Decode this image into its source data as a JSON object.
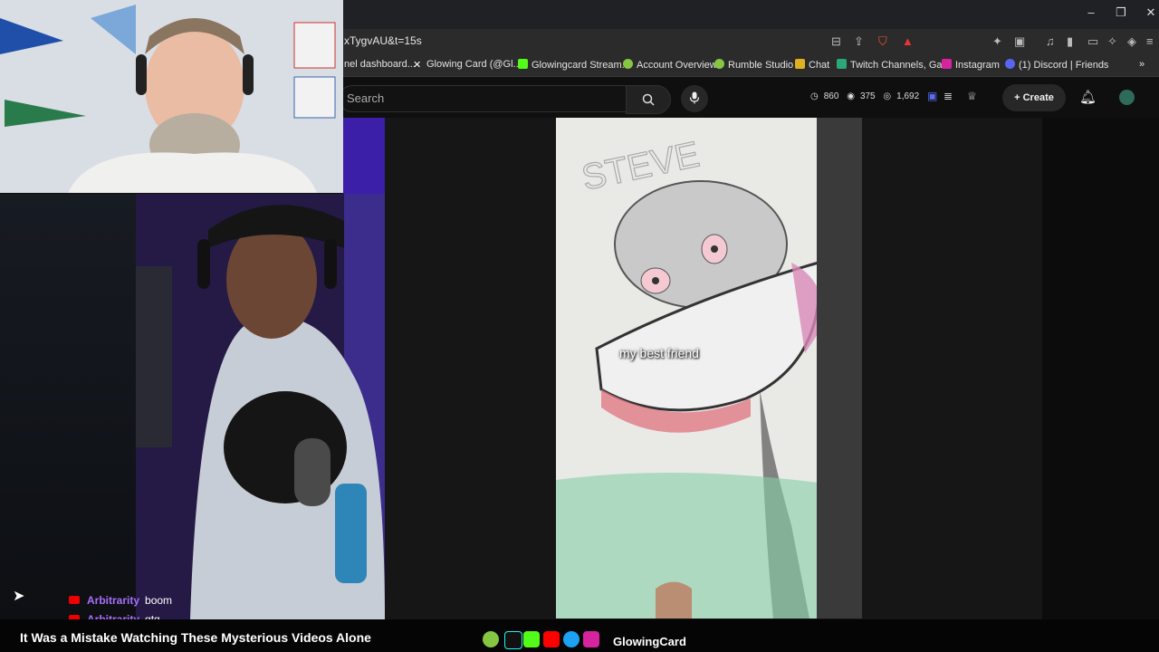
{
  "browser": {
    "url": "xTygvAU&t=15s",
    "window_controls": [
      "–",
      "❐",
      "✕"
    ],
    "bookmarks": [
      {
        "label": "nel dashboard...",
        "icon": "channel-icon",
        "color": "#555555"
      },
      {
        "label": "Glowing Card (@Gl...",
        "icon": "x-icon",
        "color": "#ffffff"
      },
      {
        "label": "Glowingcard Stream...",
        "icon": "kick-icon",
        "color": "#53fc18"
      },
      {
        "label": "Account Overview",
        "icon": "rumble-icon",
        "color": "#85c742"
      },
      {
        "label": "Rumble Studio",
        "icon": "rumble-icon",
        "color": "#85c742"
      },
      {
        "label": "Chat",
        "icon": "chat-icon",
        "color": "#e0b020"
      },
      {
        "label": "Twitch Channels, Ga...",
        "icon": "tt-icon",
        "color": "#2aa876"
      },
      {
        "label": "Instagram",
        "icon": "instagram-icon",
        "color": "#d6249f"
      },
      {
        "label": "(1) Discord | Friends",
        "icon": "discord-icon",
        "color": "#5865f2"
      }
    ]
  },
  "youtube_header": {
    "search_placeholder": "Search",
    "stats": {
      "clock": "860",
      "eye": "375",
      "views": "1,692"
    },
    "create_label": "Create"
  },
  "video": {
    "caption": "my best friend",
    "drawing_text": "STEVE"
  },
  "chat": [
    {
      "user": "Arbitrarity",
      "message": "boom"
    },
    {
      "user": "Arbitrarity",
      "message": "gtg"
    }
  ],
  "bottom_bar": {
    "ticker": "It Was a Mistake Watching These Mysterious Videos Alone",
    "brand": "GlowingCard",
    "social_icons": [
      "rumble-icon",
      "tiktok-icon",
      "kick-icon",
      "youtube-icon",
      "twitter-icon",
      "instagram-icon"
    ]
  },
  "colors": {
    "accent_purple": "#a970ff",
    "youtube_red": "#ff0000",
    "background": "#0f0f0f"
  }
}
